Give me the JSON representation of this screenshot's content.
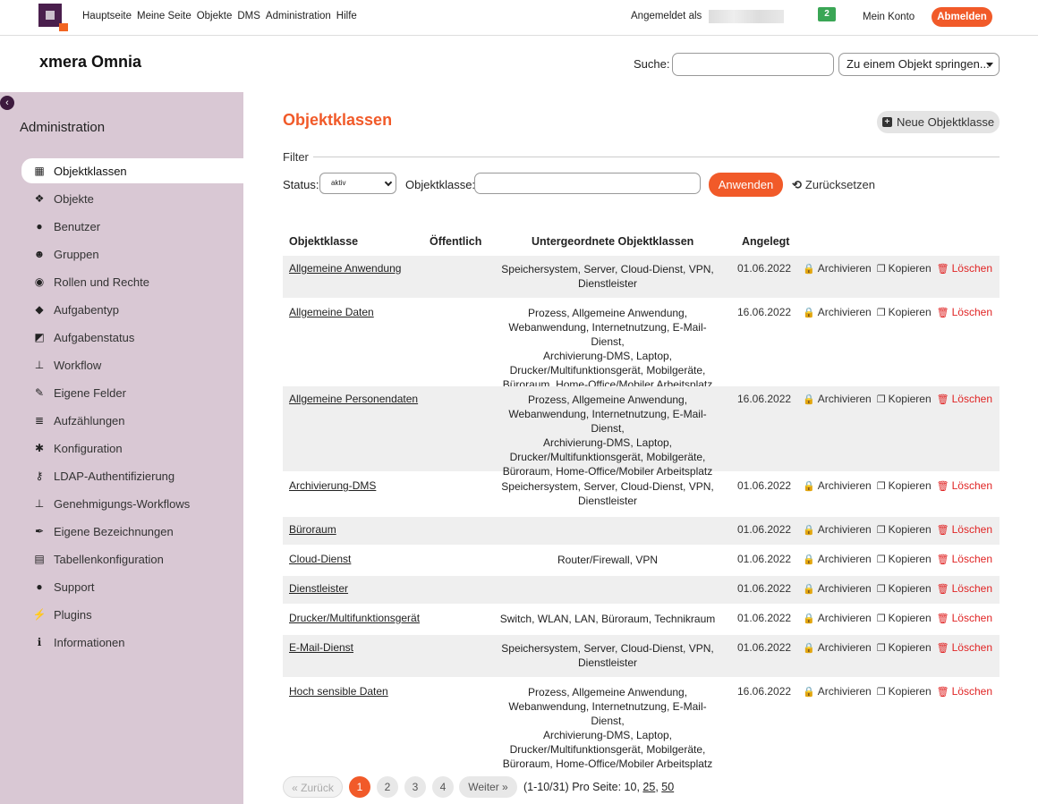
{
  "topbar": {
    "menu": [
      "Hauptseite",
      "Meine Seite",
      "Objekte",
      "DMS",
      "Administration",
      "Hilfe"
    ],
    "login_label": "Angemeldet als",
    "notification_count": "2",
    "my_account": "Mein Konto",
    "logout": "Abmelden"
  },
  "header": {
    "site_title": "xmera Omnia",
    "search_label": "Suche:",
    "jump_placeholder": "Zu einem Objekt springen..."
  },
  "sidebar": {
    "title": "Administration",
    "items": [
      {
        "label": "Objektklassen",
        "icon": "grid-icon",
        "glyph": "▦",
        "active": true
      },
      {
        "label": "Objekte",
        "icon": "cubes-icon",
        "glyph": "❖"
      },
      {
        "label": "Benutzer",
        "icon": "user-icon",
        "glyph": "●"
      },
      {
        "label": "Gruppen",
        "icon": "users-icon",
        "glyph": "☻"
      },
      {
        "label": "Rollen und Rechte",
        "icon": "eye-icon",
        "glyph": "◉"
      },
      {
        "label": "Aufgabentyp",
        "icon": "tag-icon",
        "glyph": "◆"
      },
      {
        "label": "Aufgabenstatus",
        "icon": "edit-square-icon",
        "glyph": "◩"
      },
      {
        "label": "Workflow",
        "icon": "sitemap-icon",
        "glyph": "⊥"
      },
      {
        "label": "Eigene Felder",
        "icon": "edit-icon",
        "glyph": "✎"
      },
      {
        "label": "Aufzählungen",
        "icon": "list-icon",
        "glyph": "≣"
      },
      {
        "label": "Konfiguration",
        "icon": "gear-icon",
        "glyph": "✱"
      },
      {
        "label": "LDAP-Authentifizierung",
        "icon": "key-icon",
        "glyph": "⚷"
      },
      {
        "label": "Genehmigungs-Workflows",
        "icon": "sitemap-icon",
        "glyph": "⊥"
      },
      {
        "label": "Eigene Bezeichnungen",
        "icon": "pen-icon",
        "glyph": "✒"
      },
      {
        "label": "Tabellenkonfiguration",
        "icon": "table-icon",
        "glyph": "▤"
      },
      {
        "label": "Support",
        "icon": "chat-icon",
        "glyph": "●"
      },
      {
        "label": "Plugins",
        "icon": "plug-icon",
        "glyph": "⚡"
      },
      {
        "label": "Informationen",
        "icon": "info-icon",
        "glyph": "ℹ"
      }
    ]
  },
  "main": {
    "title": "Objektklassen",
    "new_button": "Neue Objektklasse",
    "filter": {
      "legend": "Filter",
      "status_label": "Status:",
      "status_value": "aktiv",
      "objclass_label": "Objektklasse:",
      "apply": "Anwenden",
      "reset": "Zurücksetzen"
    },
    "table": {
      "headers": [
        "Objektklasse",
        "Öffentlich",
        "Untergeordnete Objektklassen",
        "Angelegt"
      ],
      "actions": {
        "archive": "Archivieren",
        "copy": "Kopieren",
        "delete": "Löschen"
      },
      "rows": [
        {
          "name": "Allgemeine Anwendung",
          "sub": [
            "Speichersystem, Server, Cloud-Dienst, VPN,",
            "Dienstleister"
          ],
          "date": "01.06.2022"
        },
        {
          "name": "Allgemeine Daten",
          "sub": [
            "Prozess, Allgemeine Anwendung,",
            "Webanwendung, Internetnutzung, E-Mail-Dienst,",
            "Archivierung-DMS, Laptop,",
            "Drucker/Multifunktionsgerät, Mobilgeräte,",
            "Büroraum, Home-Office/Mobiler Arbeitsplatz"
          ],
          "date": "16.06.2022"
        },
        {
          "name": "Allgemeine Personendaten",
          "sub": [
            "Prozess, Allgemeine Anwendung,",
            "Webanwendung, Internetnutzung, E-Mail-Dienst,",
            "Archivierung-DMS, Laptop,",
            "Drucker/Multifunktionsgerät, Mobilgeräte,",
            "Büroraum, Home-Office/Mobiler Arbeitsplatz"
          ],
          "date": "16.06.2022"
        },
        {
          "name": "Archivierung-DMS",
          "sub": [
            "Speichersystem, Server, Cloud-Dienst, VPN,",
            "Dienstleister"
          ],
          "date": "01.06.2022"
        },
        {
          "name": "Büroraum",
          "sub": [],
          "date": "01.06.2022"
        },
        {
          "name": "Cloud-Dienst",
          "sub": [
            "Router/Firewall, VPN"
          ],
          "date": "01.06.2022"
        },
        {
          "name": "Dienstleister",
          "sub": [],
          "date": "01.06.2022"
        },
        {
          "name": "Drucker/Multifunktionsgerät",
          "sub": [
            "Switch, WLAN, LAN, Büroraum, Technikraum"
          ],
          "date": "01.06.2022"
        },
        {
          "name": "E-Mail-Dienst",
          "sub": [
            "Speichersystem, Server, Cloud-Dienst, VPN,",
            "Dienstleister"
          ],
          "date": "01.06.2022"
        },
        {
          "name": "Hoch sensible Daten",
          "sub": [
            "Prozess, Allgemeine Anwendung,",
            "Webanwendung, Internetnutzung, E-Mail-Dienst,",
            "Archivierung-DMS, Laptop,",
            "Drucker/Multifunktionsgerät, Mobilgeräte,",
            "Büroraum, Home-Office/Mobiler Arbeitsplatz"
          ],
          "date": "16.06.2022"
        }
      ]
    },
    "pagination": {
      "prev": "« Zurück",
      "pages": [
        "1",
        "2",
        "3",
        "4"
      ],
      "current": "1",
      "next": "Weiter »",
      "info": "(1-10/31)  Pro Seite: 10, ",
      "per_page_25": "25",
      "sep": ", ",
      "per_page_50": "50"
    }
  },
  "colors": {
    "accent": "#f15a29",
    "sidebar": "#d9c8d4",
    "brand": "#4a1f4d",
    "badge": "#3aa655",
    "delete": "#e02424"
  }
}
